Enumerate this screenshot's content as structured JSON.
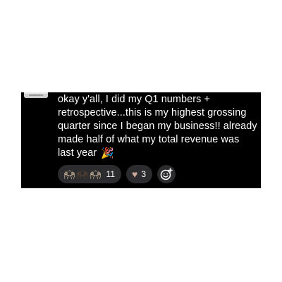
{
  "post": {
    "message": "okay y'all, I did my Q1 numbers + retrospective...this is my highest grossing quarter since I began my business!! already made half of what my total revenue was last year",
    "emoji": "🎉"
  },
  "reactions": {
    "hands_count": "11",
    "heart_count": "3"
  },
  "icons": {
    "hands": "raised-hands-icon",
    "heart": "heart-icon",
    "add": "add-reaction-icon"
  },
  "colors": {
    "background": "#000000",
    "pill": "#2c2c2e",
    "text": "#ffffff"
  }
}
